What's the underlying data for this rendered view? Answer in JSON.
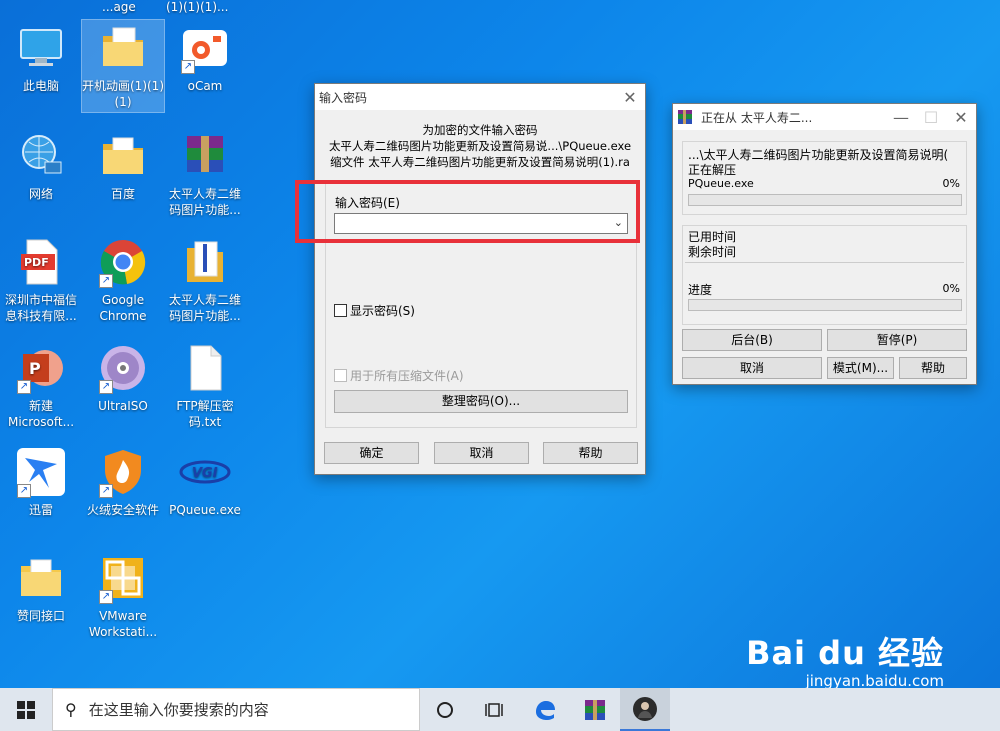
{
  "desktop": {
    "partial_top": [
      "...age",
      "(1)(1)(1)..."
    ],
    "icons": [
      {
        "label": "此电脑"
      },
      {
        "label": "开机动画(1)(1)(1)"
      },
      {
        "label": "oCam"
      },
      {
        "label": "网络"
      },
      {
        "label": "百度"
      },
      {
        "label": "太平人寿二维码图片功能..."
      },
      {
        "label": "深圳市中福信息科技有限..."
      },
      {
        "label": "Google Chrome"
      },
      {
        "label": "太平人寿二维码图片功能..."
      },
      {
        "label": "新建 Microsoft..."
      },
      {
        "label": "UltraISO"
      },
      {
        "label": "FTP解压密码.txt"
      },
      {
        "label": "迅雷"
      },
      {
        "label": "火绒安全软件"
      },
      {
        "label": "PQueue.exe"
      },
      {
        "label": "赞同接口"
      },
      {
        "label": "VMware Workstati..."
      }
    ]
  },
  "password_dialog": {
    "title": "输入密码",
    "caption_lines": [
      "为加密的文件输入密码",
      "太平人寿二维码图片功能更新及设置简易说...\\PQueue.exe",
      "缩文件 太平人寿二维码图片功能更新及设置简易说明(1).ra"
    ],
    "password_label": "输入密码(E)",
    "password_value": "",
    "show_password_label": "显示密码(S)",
    "use_all_label": "用于所有压缩文件(A)",
    "organize_button": "整理密码(O)...",
    "ok_button": "确定",
    "cancel_button": "取消",
    "help_button": "帮助"
  },
  "extract_window": {
    "title": "正在从 太平人寿二...",
    "path_line": "...\\太平人寿二维码图片功能更新及设置简易说明(",
    "status": "正在解压",
    "file_name": "PQueue.exe",
    "file_percent": "0%",
    "file_progress": 0,
    "elapsed_label": "已用时间",
    "remaining_label": "剩余时间",
    "progress_label": "进度",
    "total_percent": "0%",
    "total_progress": 0,
    "background_button": "后台(B)",
    "pause_button": "暂停(P)",
    "cancel_button": "取消",
    "mode_button": "模式(M)...",
    "help_button": "帮助"
  },
  "taskbar": {
    "search_placeholder": "在这里输入你要搜索的内容"
  },
  "watermark": {
    "brand": "Bai du 经验",
    "url": "jingyan.baidu.com"
  },
  "colors": {
    "highlight": "#e8313a",
    "desktop": "#0d86ea"
  }
}
